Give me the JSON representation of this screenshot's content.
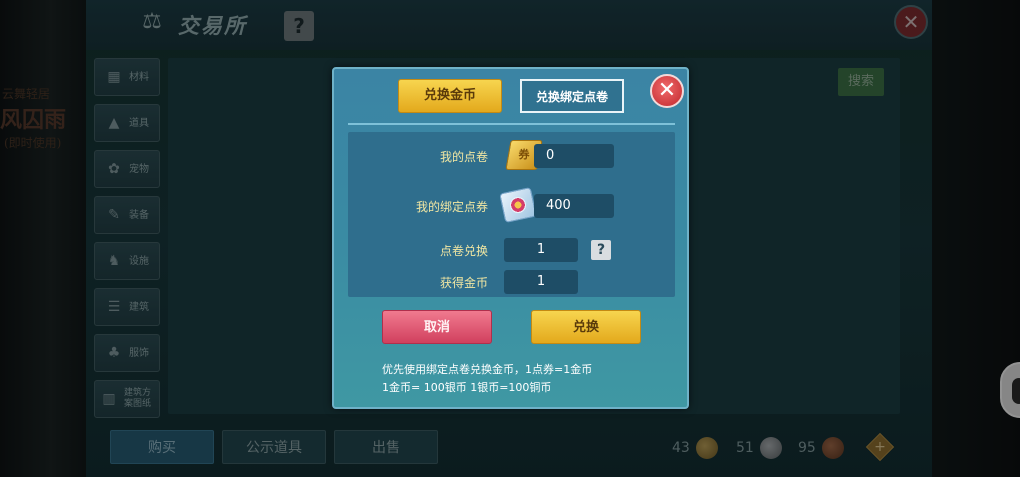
{
  "background": {
    "left_deco": {
      "line1": "云舞轻居",
      "line2": "风囚雨",
      "line3": "(即时使用)"
    },
    "window_title": "交易所",
    "help_label": "?",
    "close_label": "✕",
    "sidebar": [
      {
        "icon": "materials-icon",
        "glyph": "▦",
        "label": "材料"
      },
      {
        "icon": "props-icon",
        "glyph": "▲",
        "label": "道具"
      },
      {
        "icon": "pet-icon",
        "glyph": "✿",
        "label": "宠物"
      },
      {
        "icon": "equipment-icon",
        "glyph": "✎",
        "label": "装备"
      },
      {
        "icon": "mount-icon",
        "glyph": "♞",
        "label": "设施"
      },
      {
        "icon": "building-icon",
        "glyph": "☰",
        "label": "建筑"
      },
      {
        "icon": "costume-icon",
        "glyph": "♣",
        "label": "服饰"
      },
      {
        "icon": "blueprint-icon",
        "glyph": "▥",
        "label": "建筑方案图纸"
      }
    ],
    "search_label": "搜索",
    "tabs": {
      "buy": "购买",
      "public": "公示道具",
      "sell": "出售"
    },
    "currency": {
      "gold": "43",
      "silver": "51",
      "copper": "95"
    },
    "plus_label": "+"
  },
  "dialog": {
    "tab_active": "兑换金币",
    "tab_inactive": "兑换绑定点卷",
    "close_label": "✕",
    "my_points_label": "我的点卷",
    "my_points_value": "0",
    "my_bound_label": "我的绑定点券",
    "my_bound_value": "400",
    "exchange_label": "点卷兑换",
    "exchange_value": "1",
    "gain_label": "获得金币",
    "gain_value": "1",
    "help_label": "?",
    "cancel_label": "取消",
    "confirm_label": "兑换",
    "note_line1": "优先使用绑定点卷兑换金币，1点券=1金币",
    "note_line2": "1金币= 100银币  1银币=100铜币",
    "voucher_glyph": "券"
  },
  "colors": {
    "accent_gold": "#e3a91c",
    "cancel_red": "#d1405e",
    "dialog_blue": "#3a8aa3",
    "label_yellow": "#f1e7a3"
  }
}
